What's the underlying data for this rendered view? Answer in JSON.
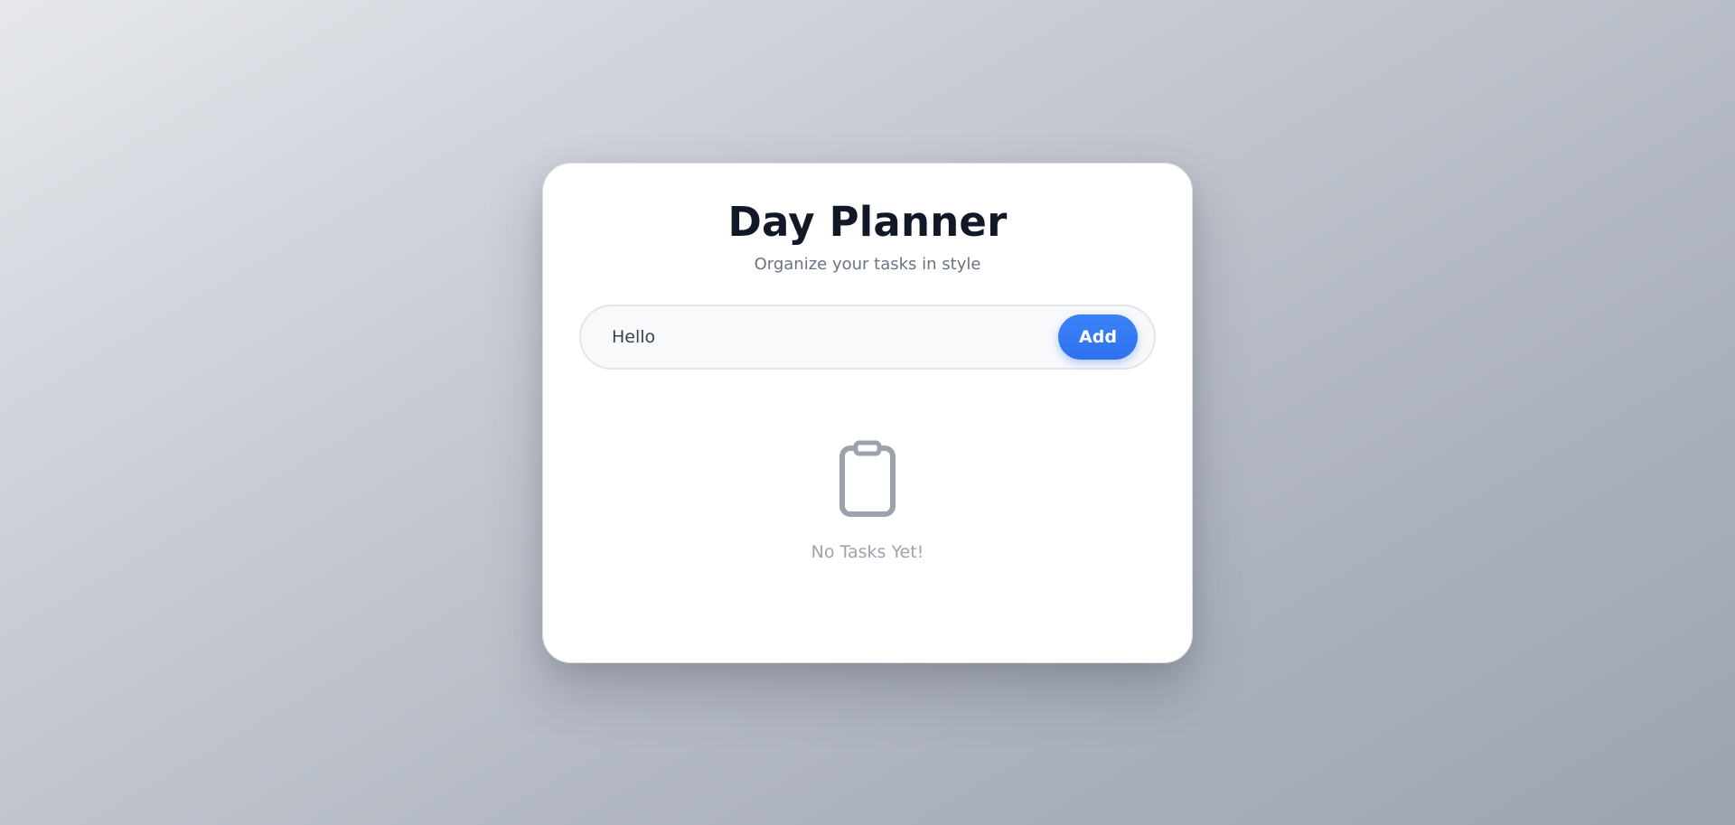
{
  "app": {
    "title": "Day Planner",
    "subtitle": "Organize your tasks in style"
  },
  "task_form": {
    "input_value": "Hello",
    "input_placeholder": "",
    "add_label": "Add"
  },
  "empty_state": {
    "icon": "clipboard-icon",
    "message": "No Tasks Yet!"
  },
  "colors": {
    "accent": "#2f72f0",
    "title": "#111827",
    "muted": "#9ca3af"
  }
}
